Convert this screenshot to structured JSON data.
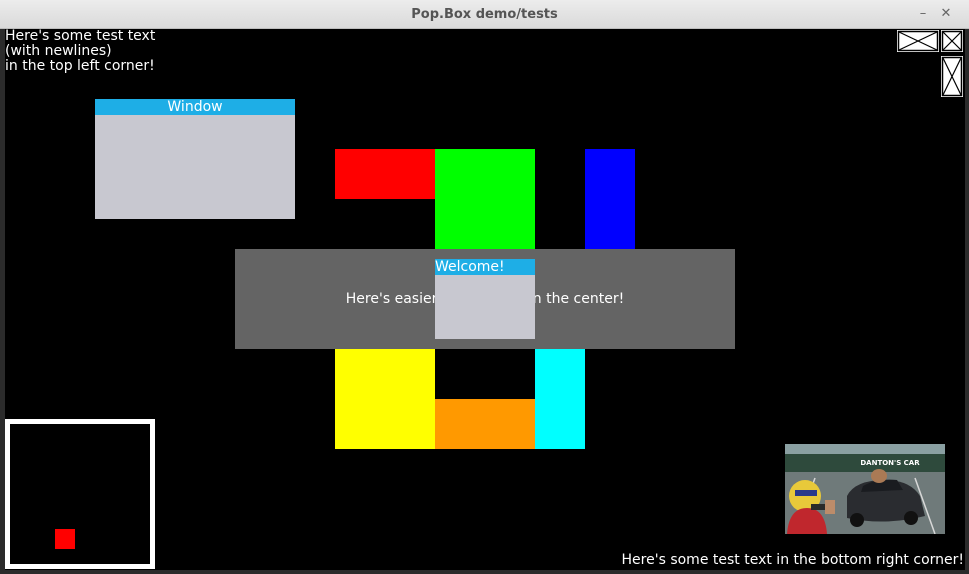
{
  "window": {
    "title": "Pop.Box demo/tests",
    "minimize_glyph": "–",
    "close_glyph": "✕"
  },
  "canvas": {
    "top_left_text": "Here's some test text\n(with newlines)\nin the top left corner!",
    "bottom_right_text": "Here's some test text in the bottom right corner!",
    "center_text": "Here's easier-to-read text in the center!",
    "window_panel": {
      "title": "Window"
    },
    "welcome_panel": {
      "title": "Welcome!"
    },
    "photo_caption": "DANTON'S CAR"
  },
  "colors": {
    "canvas_bg": "#000000",
    "panel_title": "#1eaee6",
    "panel_body": "#c8c8d0",
    "overlay": "#646464",
    "red": "#ff0000",
    "green": "#00ff00",
    "blue": "#0000ff",
    "yellow": "#ffff00",
    "orange": "#ff9900",
    "cyan": "#00ffff"
  }
}
